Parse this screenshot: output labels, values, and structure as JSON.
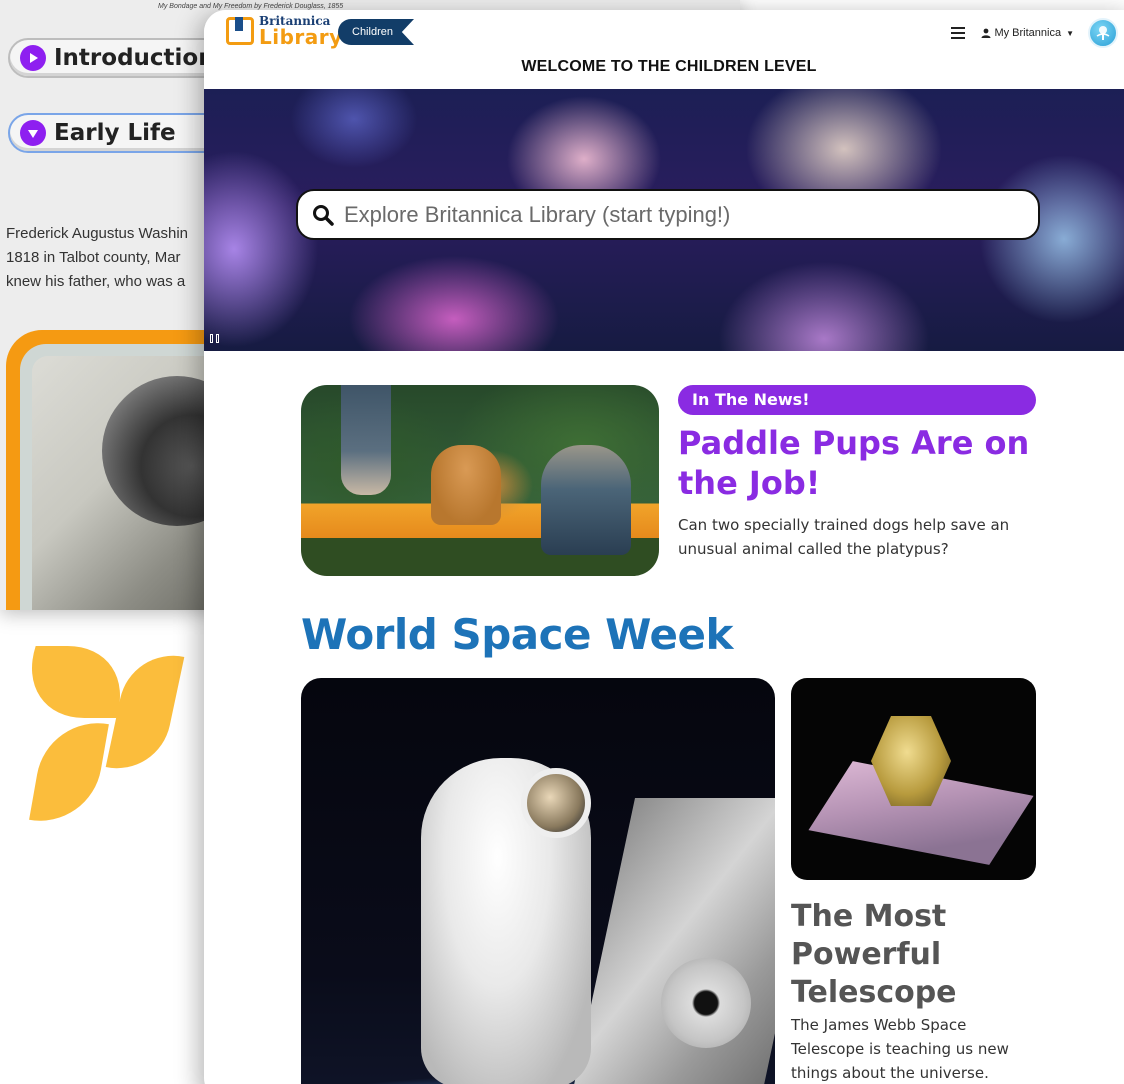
{
  "background_article": {
    "caption": "My Bondage and My Freedom by Frederick Douglass, 1855",
    "sections": [
      {
        "label": "Introduction",
        "state": "collapsed"
      },
      {
        "label": "Early Life",
        "state": "expanded"
      }
    ],
    "body_lines": [
      "Frederick Augustus Washin",
      "1818 in Talbot county, Mar",
      "knew his father, who was a"
    ]
  },
  "header": {
    "logo": {
      "top": "Britannica",
      "bottom": "Library"
    },
    "level_badge": "Children",
    "menu_icon": "hamburger-icon",
    "account_label": "My Britannica",
    "account_icon": "user-icon",
    "globe_icon": "britannica-globe-icon"
  },
  "welcome_banner": "WELCOME TO THE CHILDREN LEVEL",
  "search": {
    "placeholder": "Explore Britannica Library (start typing!)",
    "value": "",
    "icon": "search-icon"
  },
  "news": {
    "tag": "In The News!",
    "title": "Paddle Pups Are on the Job!",
    "description": "Can two specially trained dogs help save an unusual animal called the platypus?"
  },
  "featured_section": {
    "heading": "World Space Week",
    "side_article": {
      "title": "The Most Powerful Telescope",
      "description": "The James Webb Space Telescope is teaching us new things about the universe."
    }
  },
  "colors": {
    "accent_purple": "#8a2be2",
    "heading_blue": "#1d73b8",
    "logo_orange": "#f39c12",
    "badge_navy": "#123d68"
  }
}
